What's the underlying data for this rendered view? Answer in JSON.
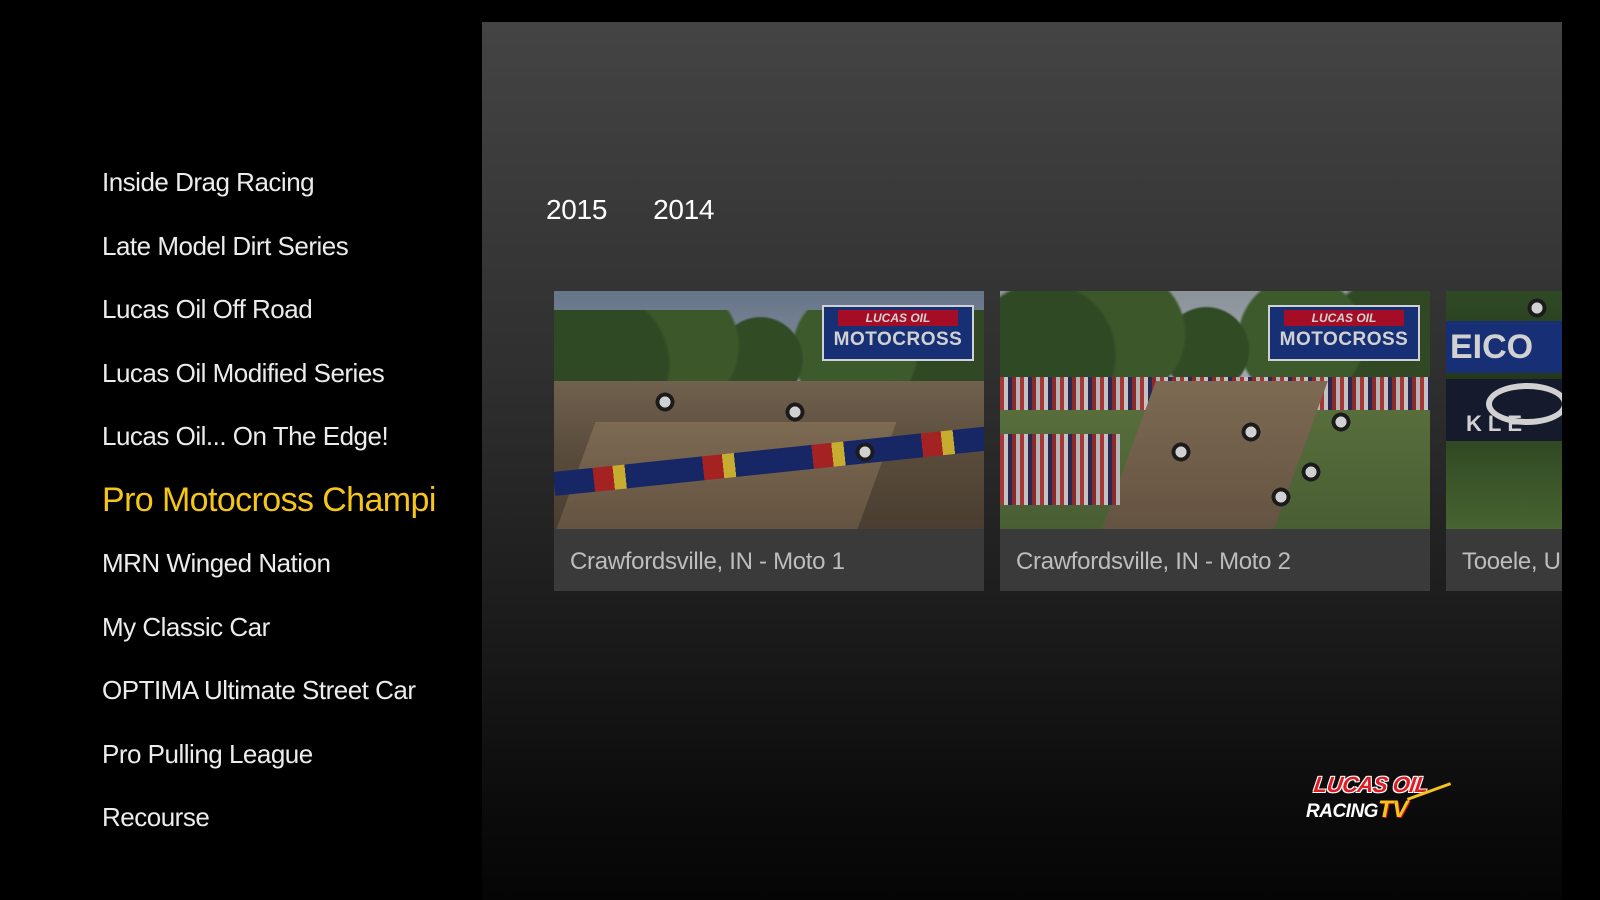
{
  "sidebar": {
    "items": [
      {
        "label": "Inside Drag Racing",
        "active": false
      },
      {
        "label": "Late Model Dirt Series",
        "active": false
      },
      {
        "label": "Lucas Oil Off Road",
        "active": false
      },
      {
        "label": "Lucas Oil Modified Series",
        "active": false
      },
      {
        "label": "Lucas Oil... On The Edge!",
        "active": false
      },
      {
        "label": "Pro Motocross Champi",
        "active": true
      },
      {
        "label": "MRN Winged Nation",
        "active": false
      },
      {
        "label": "My Classic Car",
        "active": false
      },
      {
        "label": "OPTIMA Ultimate Street Car",
        "active": false
      },
      {
        "label": "Pro Pulling League",
        "active": false
      },
      {
        "label": "Recourse",
        "active": false
      }
    ]
  },
  "year_tabs": [
    "2015",
    "2014"
  ],
  "videos": [
    {
      "title": "Crawfordsville, IN - Moto 1",
      "thumb_logo_top": "LUCAS OIL",
      "thumb_logo_bottom": "MOTOCROSS"
    },
    {
      "title": "Crawfordsville, IN - Moto 2",
      "thumb_logo_top": "LUCAS OIL",
      "thumb_logo_bottom": "MOTOCROSS"
    },
    {
      "title": "Tooele, U",
      "thumb_sign_1": "EICO",
      "thumb_sign_2": "KLE"
    }
  ],
  "brand": {
    "line1": "LUCAS OIL",
    "line2": "RACING",
    "line2_tv": "TV"
  },
  "colors": {
    "background": "#000000",
    "active_item": "#f5c518",
    "inactive_item": "#ececec",
    "card_caption": "#bdbdbd",
    "card_bg": "#3a3a3a"
  }
}
